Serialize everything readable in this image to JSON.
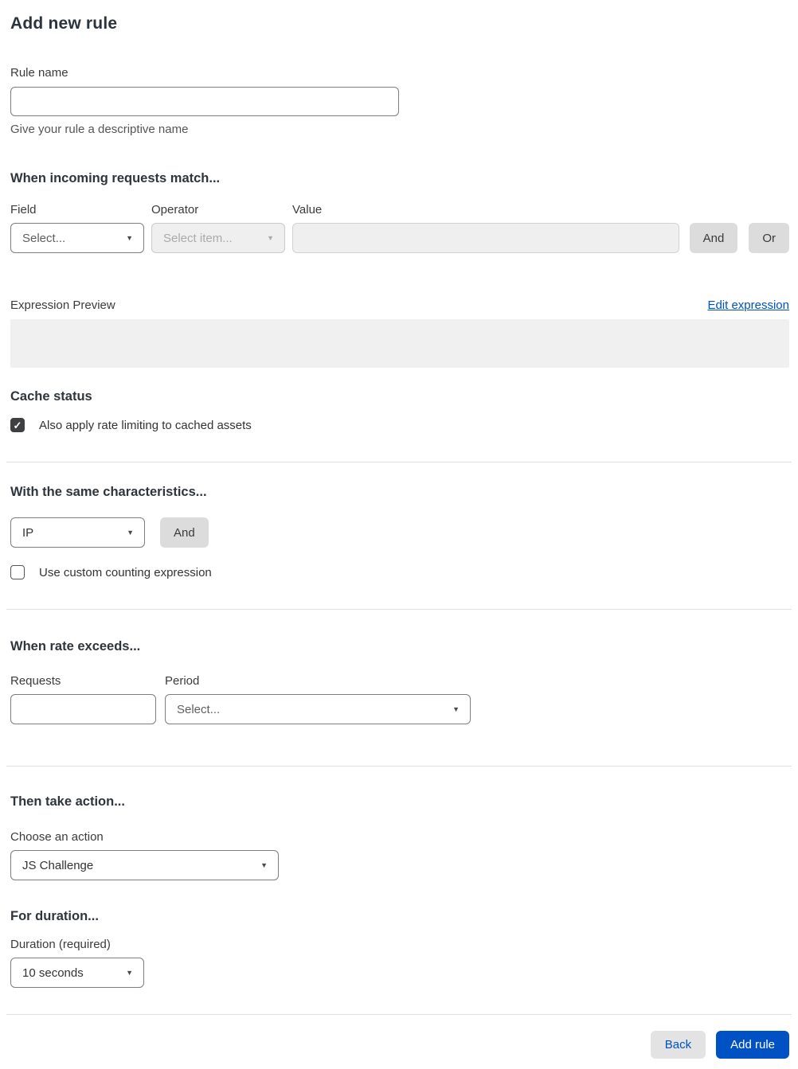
{
  "page": {
    "title": "Add new rule"
  },
  "rule_name": {
    "label": "Rule name",
    "value": "",
    "helper": "Give your rule a descriptive name"
  },
  "match_section": {
    "heading": "When incoming requests match...",
    "field": {
      "label": "Field",
      "selected": "Select...",
      "enabled": true
    },
    "operator": {
      "label": "Operator",
      "selected": "Select item...",
      "enabled": false
    },
    "value": {
      "label": "Value",
      "value": "",
      "enabled": false
    },
    "and_button": "And",
    "or_button": "Or"
  },
  "expression": {
    "preview_label": "Expression Preview",
    "edit_link": "Edit expression",
    "preview_value": ""
  },
  "cache_status": {
    "heading": "Cache status",
    "checkbox_label": "Also apply rate limiting to cached assets",
    "checked": true
  },
  "characteristics": {
    "heading": "With the same characteristics...",
    "selected": "IP",
    "and_button": "And",
    "custom_counting_label": "Use custom counting expression",
    "custom_counting_checked": false
  },
  "rate": {
    "heading": "When rate exceeds...",
    "requests": {
      "label": "Requests",
      "value": ""
    },
    "period": {
      "label": "Period",
      "selected": "Select..."
    }
  },
  "action": {
    "heading": "Then take action...",
    "label": "Choose an action",
    "selected": "JS Challenge"
  },
  "duration": {
    "heading": "For duration...",
    "label": "Duration (required)",
    "selected": "10 seconds"
  },
  "footer": {
    "back_button": "Back",
    "add_rule_button": "Add rule"
  },
  "icons": {
    "chevron_down": "▼",
    "checkmark": "✓"
  },
  "colors": {
    "primary_blue": "#0051c3",
    "link_blue": "#0051c3",
    "checkbox_checked": "#3f4042",
    "disabled_bg": "#efefef",
    "preview_bg": "#f0f0f0",
    "gray_button_bg": "#dcdcdc",
    "back_button_bg": "#e3e3e3",
    "divider": "#dfdfdf"
  }
}
